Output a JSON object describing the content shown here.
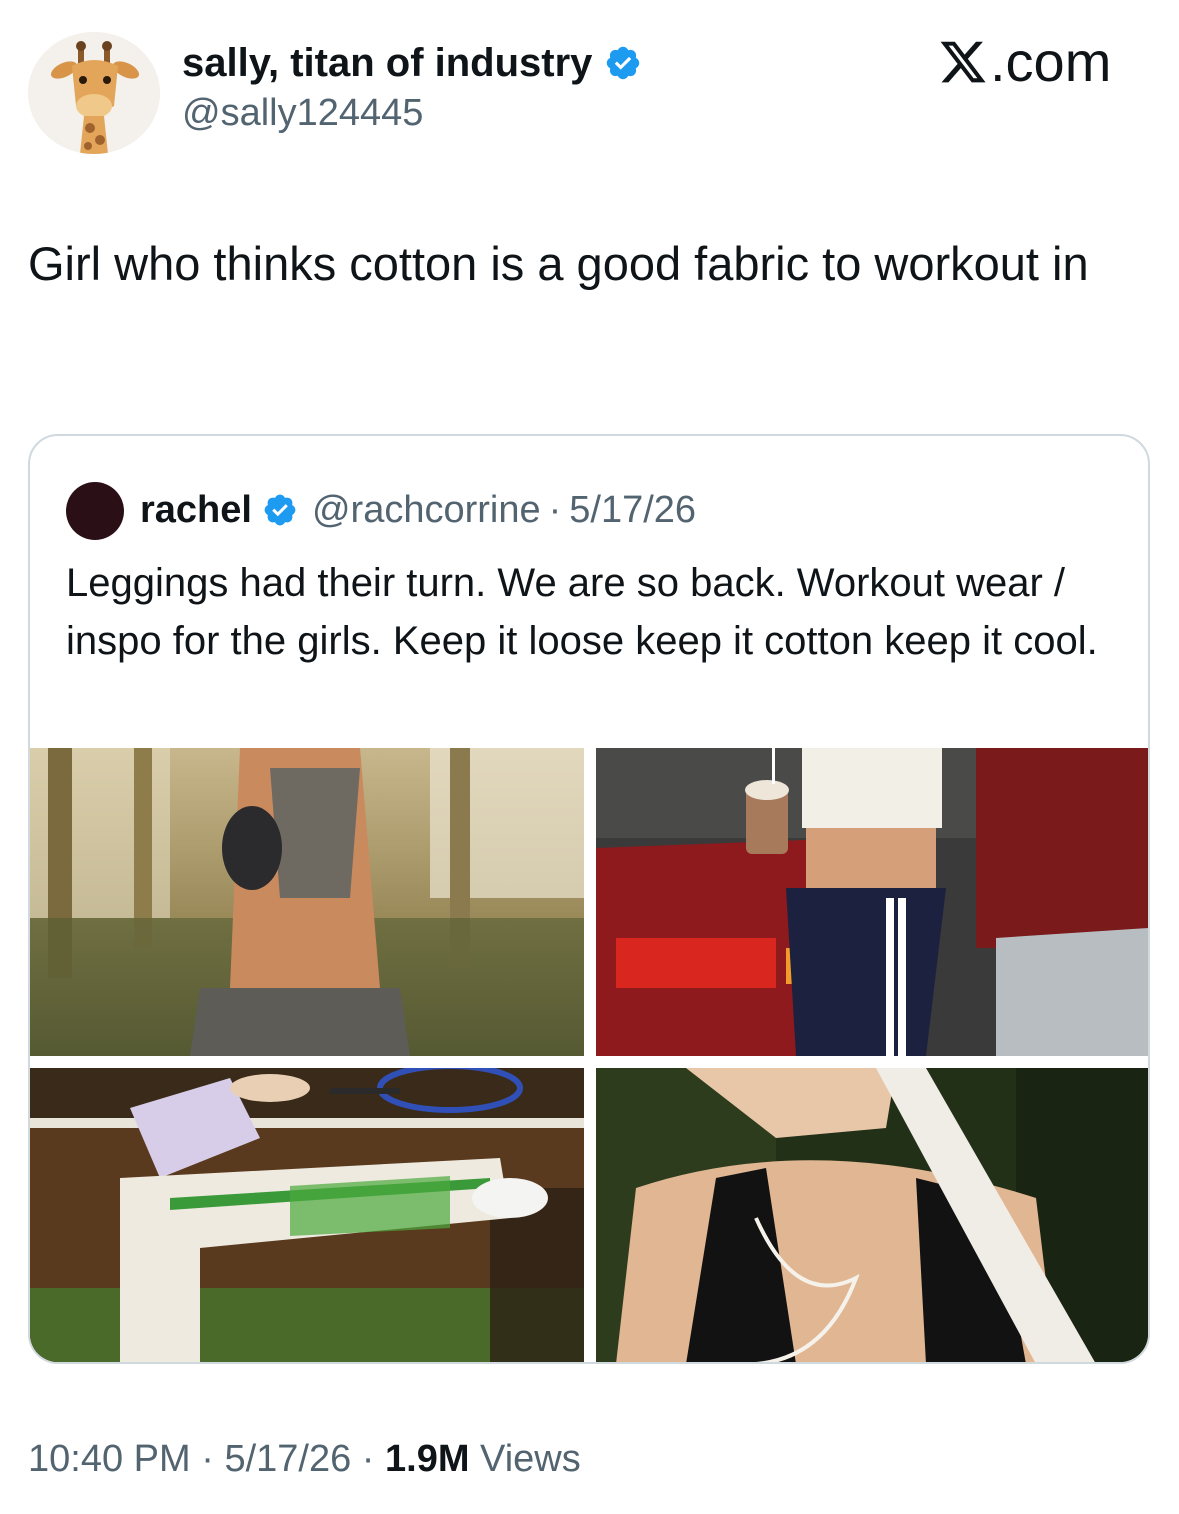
{
  "author": {
    "display_name": "sally, titan of industry",
    "handle": "@sally124445",
    "avatar_icon": "giraffe-emoji-avatar",
    "verified_icon": "verified-badge-icon"
  },
  "site": {
    "logo_text": ".com",
    "logo_icon": "x-logo-icon"
  },
  "tweet": {
    "text": "Girl who thinks cotton is a good fabric to workout in"
  },
  "quoted_tweet": {
    "name": "rachel",
    "handle": "@rachcorrine",
    "separator": "·",
    "date": "5/17/26",
    "text": "Leggings had their turn. We are so back. Workout wear / inspo for the girls. Keep it loose keep it cotton keep it cool.",
    "media": [
      {
        "icon": "photo-woman-sports-bra-joggers"
      },
      {
        "icon": "photo-woman-track-pants-drink"
      },
      {
        "icon": "photo-tennis-player-stretching"
      },
      {
        "icon": "photo-woman-black-tank-top"
      }
    ]
  },
  "meta": {
    "time": "10:40 PM",
    "sep1": " · ",
    "date": "5/17/26",
    "sep2": " · ",
    "views_count": "1.9M",
    "views_label": " Views"
  },
  "colors": {
    "text": "#0f1419",
    "secondary": "#536471",
    "border": "#cfd9de",
    "verified": "#1d9bf0"
  }
}
